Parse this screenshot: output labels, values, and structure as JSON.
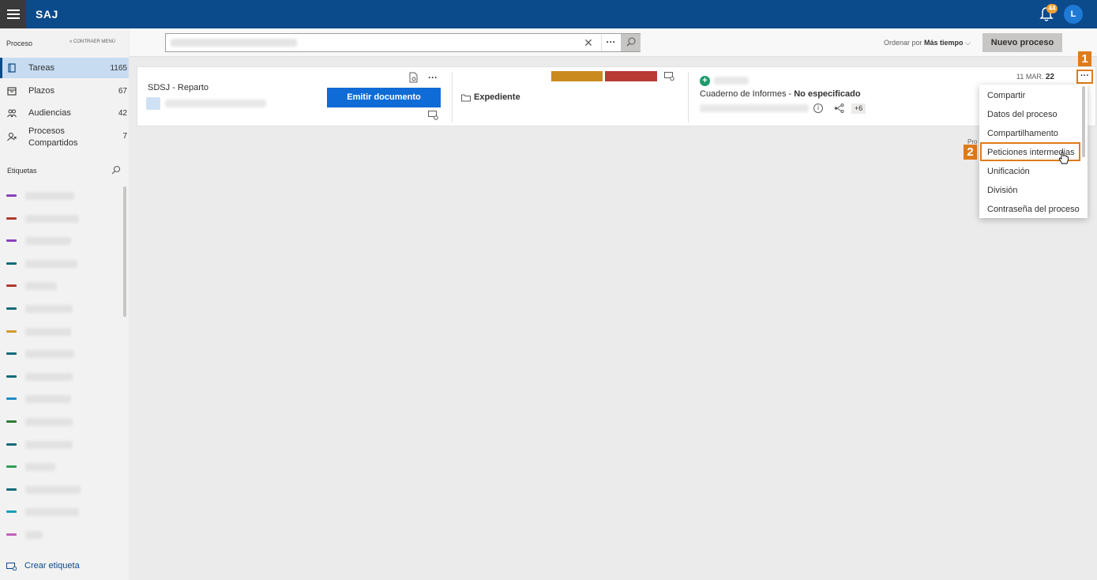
{
  "app": {
    "brand": "SAJ",
    "notifications": "44",
    "user_initial": "L"
  },
  "sidebar": {
    "header": "Proceso",
    "collapse_label": "« CONTRAER MENÚ",
    "items": [
      {
        "label": "Tareas",
        "count": "1165",
        "icon": "tasks-icon",
        "active": true
      },
      {
        "label": "Plazos",
        "count": "67",
        "icon": "calendar-icon",
        "active": false
      },
      {
        "label": "Audiencias",
        "count": "42",
        "icon": "people-icon",
        "active": false
      },
      {
        "label": "Procesos Compartidos",
        "count": "7",
        "icon": "shared-icon",
        "active": false
      }
    ],
    "tags_header": "Etiquetas",
    "tag_colors": [
      "#8c3fbf",
      "#b03a2e",
      "#8c3fbf",
      "#0e6b7a",
      "#b03a2e",
      "#0e6b7a",
      "#d39a2c",
      "#0e6b7a",
      "#0e6b7a",
      "#1f8bc8",
      "#2f7d32",
      "#0e6b7a",
      "#2f9e54",
      "#0e6b7a",
      "#18a0b8",
      "#c061b8"
    ],
    "create_tag": "Crear etiqueta"
  },
  "toolbar": {
    "sort_prefix": "Ordenar por",
    "sort_value": "Más tiempo",
    "new_process": "Nuevo proceso"
  },
  "card": {
    "title": "SDSJ - Reparto",
    "emit_button": "Emitir documento",
    "expediente": "Expediente",
    "cuaderno_label": "Cuaderno de Informes - ",
    "cuaderno_value": "No especificado",
    "plus_count": "+6",
    "date_prefix": "11 MAR.",
    "date_year": "22",
    "chip_colors": [
      "#c98a1e",
      "#b83a32"
    ]
  },
  "context_menu": {
    "items": [
      "Compartir",
      "Datos del proceso",
      "Compartilhamento",
      "Peticiones intermedias",
      "Unificación",
      "División",
      "Contraseña del proceso"
    ],
    "highlighted_index": 3
  },
  "callouts": [
    "1",
    "2"
  ],
  "partial_text": "Pro"
}
